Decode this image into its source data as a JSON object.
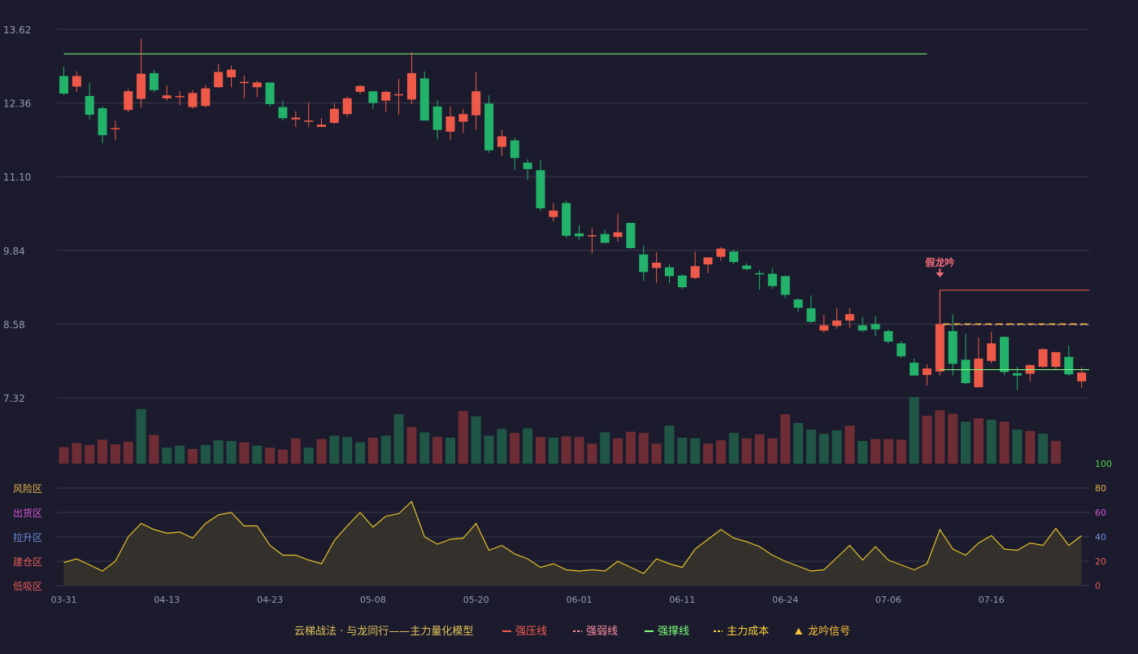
{
  "chart_data": {
    "type": "candlestick",
    "price_axis": {
      "ticks": [
        13.62,
        12.36,
        11.1,
        9.84,
        8.58,
        7.32
      ],
      "ylim": [
        7.32,
        13.62
      ],
      "grid": true
    },
    "x_axis": {
      "ticks": [
        {
          "label": "03-31",
          "index": 0
        },
        {
          "label": "04-13",
          "index": 8
        },
        {
          "label": "04-23",
          "index": 16
        },
        {
          "label": "05-08",
          "index": 24
        },
        {
          "label": "05-20",
          "index": 32
        },
        {
          "label": "06-01",
          "index": 40
        },
        {
          "label": "06-11",
          "index": 48
        },
        {
          "label": "06-24",
          "index": 56
        },
        {
          "label": "07-06",
          "index": 64
        },
        {
          "label": "07-16",
          "index": 72
        }
      ]
    },
    "candles": [
      [
        12.82,
        12.52,
        12.98,
        12.5
      ],
      [
        12.64,
        12.82,
        12.9,
        12.55
      ],
      [
        12.48,
        12.16,
        12.7,
        12.08
      ],
      [
        12.27,
        11.81,
        12.3,
        11.67
      ],
      [
        11.92,
        11.93,
        12.06,
        11.72
      ],
      [
        12.24,
        12.56,
        12.6,
        12.2
      ],
      [
        12.43,
        12.86,
        13.46,
        12.28
      ],
      [
        12.87,
        12.58,
        12.92,
        12.54
      ],
      [
        12.44,
        12.49,
        12.66,
        12.4
      ],
      [
        12.46,
        12.48,
        12.56,
        12.32
      ],
      [
        12.29,
        12.53,
        12.58,
        12.26
      ],
      [
        12.31,
        12.61,
        12.67,
        12.28
      ],
      [
        12.63,
        12.89,
        13.03,
        12.62
      ],
      [
        12.8,
        12.93,
        13.0,
        12.63
      ],
      [
        12.72,
        12.72,
        12.83,
        12.44
      ],
      [
        12.63,
        12.71,
        12.74,
        12.46
      ],
      [
        12.71,
        12.34,
        12.71,
        12.3
      ],
      [
        12.29,
        12.1,
        12.4,
        12.06
      ],
      [
        12.08,
        12.11,
        12.22,
        11.95
      ],
      [
        12.05,
        12.06,
        12.37,
        11.95
      ],
      [
        11.95,
        11.99,
        12.1,
        11.95
      ],
      [
        12.02,
        12.26,
        12.36,
        12.0
      ],
      [
        12.17,
        12.44,
        12.47,
        12.12
      ],
      [
        12.55,
        12.65,
        12.67,
        12.51
      ],
      [
        12.56,
        12.36,
        12.56,
        12.26
      ],
      [
        12.4,
        12.55,
        12.57,
        12.2
      ],
      [
        12.5,
        12.51,
        12.77,
        12.16
      ],
      [
        12.42,
        12.87,
        13.23,
        12.34
      ],
      [
        12.78,
        12.06,
        12.9,
        12.06
      ],
      [
        12.3,
        11.9,
        12.41,
        11.74
      ],
      [
        11.87,
        12.13,
        12.3,
        11.72
      ],
      [
        12.04,
        12.17,
        12.26,
        11.85
      ],
      [
        12.15,
        12.56,
        12.89,
        11.9
      ],
      [
        12.35,
        11.55,
        12.49,
        11.51
      ],
      [
        11.61,
        11.79,
        11.9,
        11.45
      ],
      [
        11.72,
        11.42,
        11.77,
        11.21
      ],
      [
        11.34,
        11.23,
        11.4,
        11.04
      ],
      [
        11.21,
        10.56,
        11.38,
        10.52
      ],
      [
        10.41,
        10.52,
        10.65,
        10.33
      ],
      [
        10.65,
        10.09,
        10.69,
        10.05
      ],
      [
        10.13,
        10.08,
        10.27,
        10.02
      ],
      [
        10.09,
        10.1,
        10.22,
        9.79
      ],
      [
        10.12,
        9.97,
        10.2,
        9.96
      ],
      [
        10.07,
        10.15,
        10.47,
        9.99
      ],
      [
        10.31,
        9.88,
        10.31,
        9.87
      ],
      [
        9.77,
        9.47,
        9.92,
        9.32
      ],
      [
        9.54,
        9.63,
        9.81,
        9.28
      ],
      [
        9.55,
        9.4,
        9.6,
        9.28
      ],
      [
        9.41,
        9.21,
        9.43,
        9.18
      ],
      [
        9.37,
        9.57,
        9.82,
        9.35
      ],
      [
        9.6,
        9.72,
        9.71,
        9.45
      ],
      [
        9.73,
        9.87,
        9.9,
        9.66
      ],
      [
        9.82,
        9.64,
        9.85,
        9.6
      ],
      [
        9.58,
        9.52,
        9.62,
        9.5
      ],
      [
        9.45,
        9.43,
        9.5,
        9.17
      ],
      [
        9.44,
        9.23,
        9.53,
        9.18
      ],
      [
        9.4,
        9.08,
        9.41,
        9.02
      ],
      [
        9.0,
        8.86,
        9.02,
        8.79
      ],
      [
        8.85,
        8.62,
        9.07,
        8.6
      ],
      [
        8.47,
        8.56,
        8.74,
        8.43
      ],
      [
        8.55,
        8.64,
        8.85,
        8.5
      ],
      [
        8.64,
        8.75,
        8.85,
        8.51
      ],
      [
        8.56,
        8.47,
        8.7,
        8.44
      ],
      [
        8.58,
        8.49,
        8.72,
        8.37
      ],
      [
        8.46,
        8.28,
        8.49,
        8.25
      ],
      [
        8.25,
        8.03,
        8.29,
        8.0
      ],
      [
        7.92,
        7.7,
        7.99,
        7.7
      ],
      [
        7.71,
        7.82,
        7.89,
        7.53
      ],
      [
        7.77,
        8.58,
        9.16,
        7.7
      ],
      [
        8.46,
        7.9,
        8.75,
        7.7
      ],
      [
        7.97,
        7.57,
        8.41,
        7.55
      ],
      [
        7.5,
        7.99,
        8.35,
        7.5
      ],
      [
        7.95,
        8.25,
        8.45,
        7.91
      ],
      [
        8.36,
        7.76,
        8.37,
        7.71
      ],
      [
        7.74,
        7.7,
        7.85,
        7.45
      ],
      [
        7.73,
        7.88,
        7.88,
        7.59
      ],
      [
        7.85,
        8.15,
        8.17,
        7.83
      ],
      [
        7.85,
        8.1,
        8.11,
        7.81
      ],
      [
        8.02,
        7.72,
        8.21,
        7.7
      ],
      [
        7.6,
        7.75,
        7.84,
        7.49
      ]
    ],
    "volume": [
      25,
      31,
      28,
      36,
      29,
      33,
      82,
      43,
      24,
      27,
      22,
      28,
      35,
      34,
      32,
      27,
      24,
      21,
      38,
      24,
      37,
      42,
      40,
      32,
      39,
      42,
      74,
      55,
      47,
      40,
      39,
      79,
      71,
      42,
      52,
      46,
      53,
      40,
      39,
      41,
      40,
      30,
      47,
      38,
      48,
      46,
      30,
      57,
      39,
      38,
      30,
      35,
      46,
      38,
      44,
      38,
      74,
      61,
      51,
      45,
      50,
      57,
      34,
      37,
      37,
      36,
      100,
      72,
      80,
      75,
      63,
      68,
      66,
      63,
      51,
      49,
      45,
      34
    ],
    "volume_up": [
      true,
      true,
      true,
      true,
      true,
      true,
      false,
      true,
      false,
      false,
      true,
      false,
      false,
      false,
      true,
      false,
      true,
      true,
      true,
      false,
      true,
      false,
      false,
      false,
      true,
      false,
      false,
      true,
      false,
      true,
      false,
      true,
      false,
      false,
      false,
      true,
      false,
      true,
      false,
      true,
      true,
      true,
      false,
      true,
      true,
      true,
      true,
      false,
      false,
      false,
      true,
      true,
      false,
      true,
      true,
      true,
      true,
      false,
      false,
      false,
      false,
      true,
      false,
      true,
      true,
      true,
      false,
      true,
      true,
      true,
      false,
      true,
      false,
      true,
      false,
      true,
      false,
      true
    ]
  },
  "indicator": {
    "ticks": [
      "100",
      "80",
      "60",
      "40",
      "20",
      "0"
    ],
    "tick_colors": [
      "#4fd34a",
      "#e4b24c",
      "#d455d6",
      "#6b8ed8",
      "#e75a5a",
      "#e75a5a"
    ],
    "zones": [
      {
        "label": "风险区",
        "color": "#e4b24c"
      },
      {
        "label": "出货区",
        "color": "#d455d6"
      },
      {
        "label": "拉升区",
        "color": "#6b8ed8"
      },
      {
        "label": "建仓区",
        "color": "#e75a5a"
      },
      {
        "label": "低吸区",
        "color": "#e75a5a"
      }
    ],
    "values": [
      19,
      22,
      17,
      12,
      20,
      40,
      51,
      46,
      43,
      44,
      39,
      51,
      58,
      60,
      49,
      49,
      33,
      25,
      25,
      21,
      18,
      37,
      49,
      60,
      48,
      57,
      59,
      69,
      40,
      34,
      38,
      39,
      51,
      29,
      33,
      26,
      22,
      15,
      18,
      13,
      12,
      13,
      12,
      20,
      15,
      10,
      22,
      18,
      15,
      30,
      38,
      46,
      39,
      36,
      32,
      25,
      20,
      16,
      12,
      13,
      23,
      33,
      21,
      32,
      21,
      17,
      13,
      18,
      46,
      30,
      25,
      35,
      41,
      30,
      29,
      35,
      33,
      47,
      33,
      41
    ]
  },
  "annotations": {
    "signal_label": "假龙吟",
    "upper_line_value": 13.2,
    "pressure_line_value": 9.16,
    "weak_line_value": 8.57,
    "cost_line_value": 8.58,
    "support_line_value": 7.8
  },
  "legend": {
    "title": "云梯战法 · 与龙同行——主力量化模型",
    "items": [
      {
        "label": "强压线",
        "color": "#f05b4f",
        "style": "solid"
      },
      {
        "label": "强弱线",
        "color": "#ff8fa0",
        "style": "dashed"
      },
      {
        "label": "强撑线",
        "color": "#7dff7a",
        "style": "solid"
      },
      {
        "label": "主力成本",
        "color": "#ffd23a",
        "style": "dashed"
      },
      {
        "label": "龙吟信号",
        "color": "#ffc23a",
        "style": "triangle"
      }
    ]
  },
  "colors": {
    "up": "#ef5a48",
    "down": "#23b26a",
    "vol_up": "#6e2d34",
    "vol_down": "#1f5645",
    "grid": "#3a3a4c",
    "axis_text": "#9a9ab0",
    "line": "#e4c22a",
    "area": "#37332b"
  }
}
